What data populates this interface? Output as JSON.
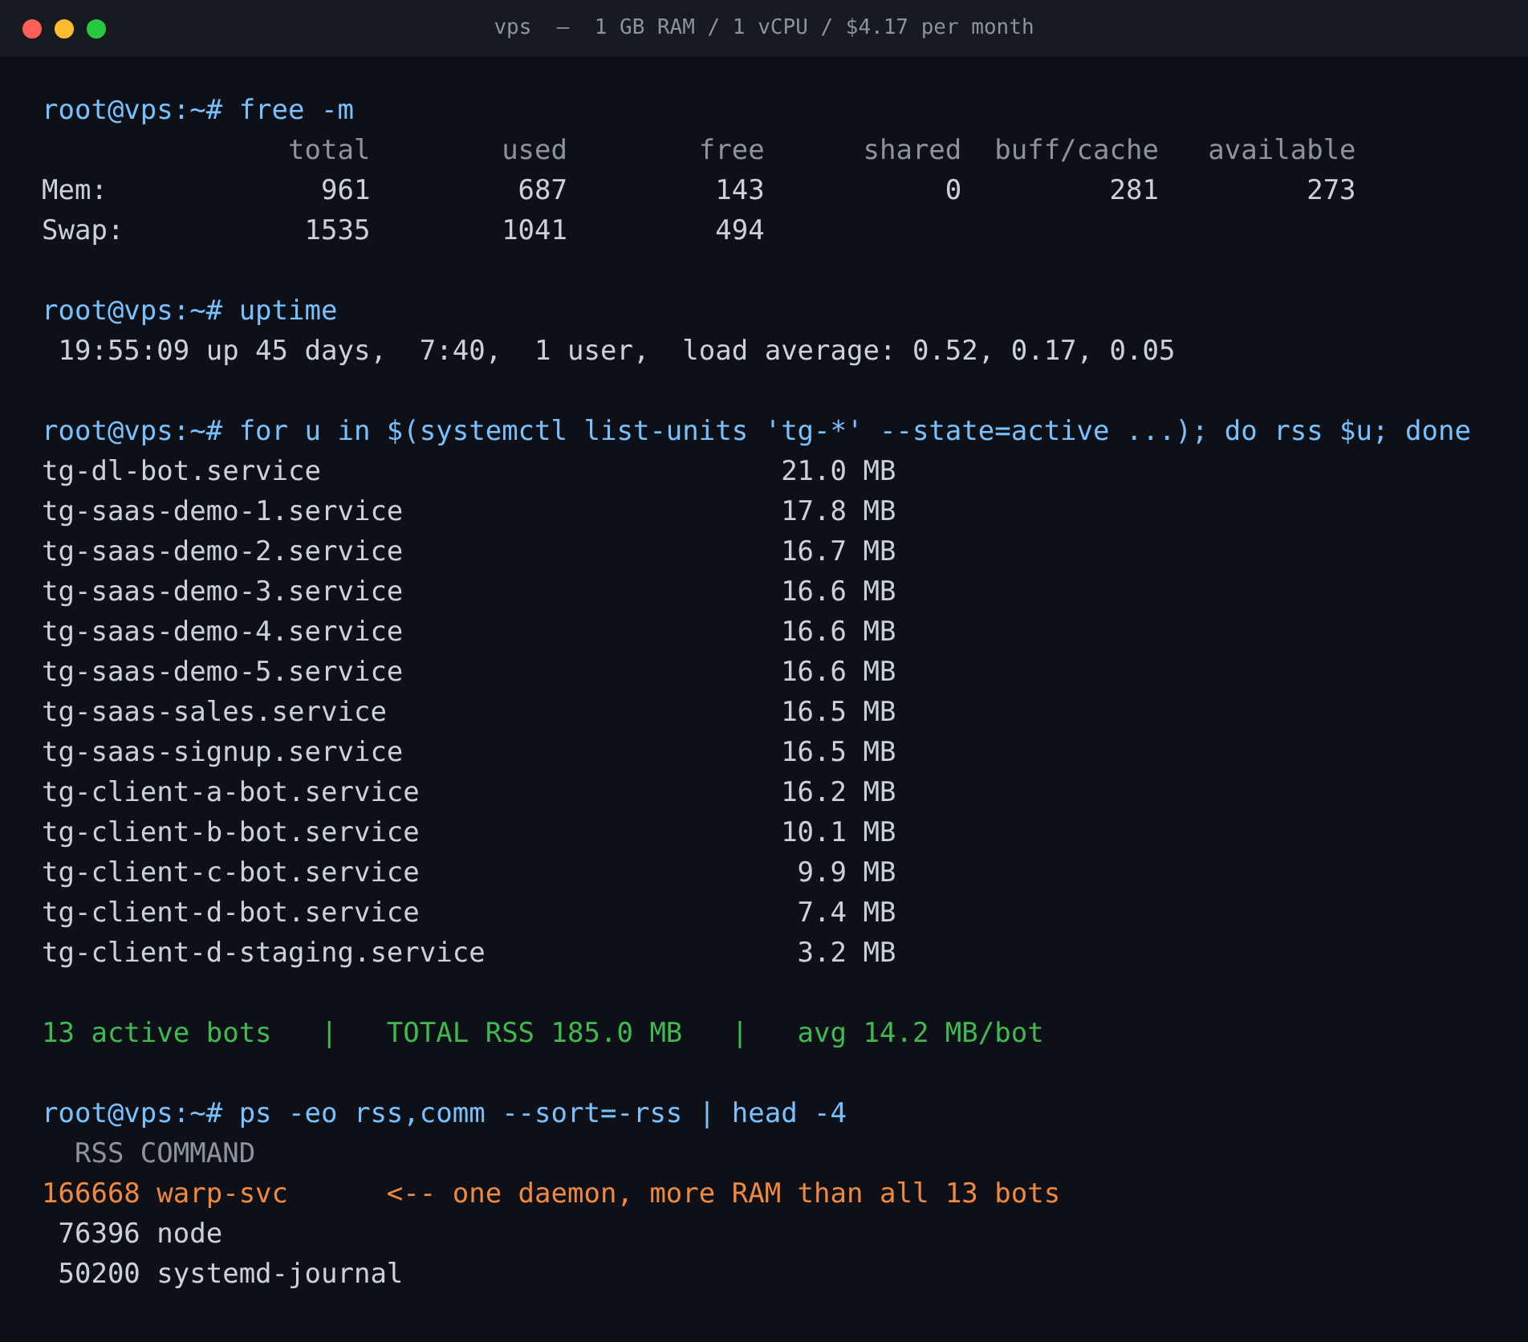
{
  "window": {
    "title": "vps  —  1 GB RAM / 1 vCPU / $4.17 per month"
  },
  "lines": [
    {
      "kind": "prompt",
      "text": "root@vps:~# free -m"
    },
    {
      "kind": "header",
      "text": "               total        used        free      shared  buff/cache   available"
    },
    {
      "kind": "output",
      "text": "Mem:             961         687         143           0         281         273"
    },
    {
      "kind": "output",
      "text": "Swap:           1535        1041         494"
    },
    {
      "kind": "blank"
    },
    {
      "kind": "prompt",
      "text": "root@vps:~# uptime"
    },
    {
      "kind": "output",
      "text": " 19:55:09 up 45 days,  7:40,  1 user,  load average: 0.52, 0.17, 0.05"
    },
    {
      "kind": "blank"
    },
    {
      "kind": "prompt",
      "text": "root@vps:~# for u in $(systemctl list-units 'tg-*' --state=active ...); do rss $u; done"
    },
    {
      "kind": "service",
      "name": "tg-dl-bot.service",
      "rss": "21.0 MB"
    },
    {
      "kind": "service",
      "name": "tg-saas-demo-1.service",
      "rss": "17.8 MB"
    },
    {
      "kind": "service",
      "name": "tg-saas-demo-2.service",
      "rss": "16.7 MB"
    },
    {
      "kind": "service",
      "name": "tg-saas-demo-3.service",
      "rss": "16.6 MB"
    },
    {
      "kind": "service",
      "name": "tg-saas-demo-4.service",
      "rss": "16.6 MB"
    },
    {
      "kind": "service",
      "name": "tg-saas-demo-5.service",
      "rss": "16.6 MB"
    },
    {
      "kind": "service",
      "name": "tg-saas-sales.service",
      "rss": "16.5 MB"
    },
    {
      "kind": "service",
      "name": "tg-saas-signup.service",
      "rss": "16.5 MB"
    },
    {
      "kind": "service",
      "name": "tg-client-a-bot.service",
      "rss": "16.2 MB"
    },
    {
      "kind": "service",
      "name": "tg-client-b-bot.service",
      "rss": "10.1 MB"
    },
    {
      "kind": "service",
      "name": "tg-client-c-bot.service",
      "rss": "9.9 MB"
    },
    {
      "kind": "service",
      "name": "tg-client-d-bot.service",
      "rss": "7.4 MB"
    },
    {
      "kind": "service",
      "name": "tg-client-d-staging.service",
      "rss": "3.2 MB"
    },
    {
      "kind": "blank"
    },
    {
      "kind": "summary",
      "text": "13 active bots   |   TOTAL RSS 185.0 MB   |   avg 14.2 MB/bot"
    },
    {
      "kind": "blank"
    },
    {
      "kind": "prompt",
      "text": "root@vps:~# ps -eo rss,comm --sort=-rss | head -4"
    },
    {
      "kind": "header",
      "text": "  RSS COMMAND"
    },
    {
      "kind": "alert",
      "text": "166668 warp-svc      <-- one daemon, more RAM than all 13 bots"
    },
    {
      "kind": "output",
      "text": " 76396 node"
    },
    {
      "kind": "output",
      "text": " 50200 systemd-journal"
    }
  ]
}
